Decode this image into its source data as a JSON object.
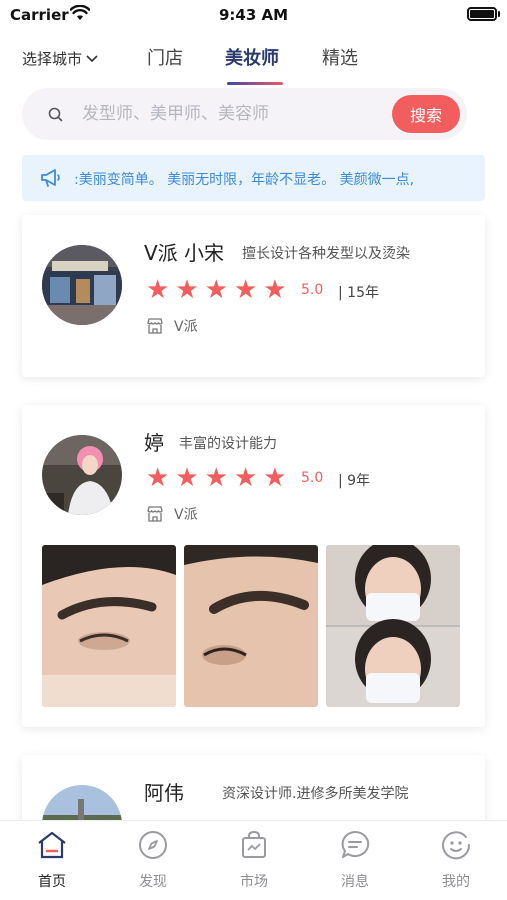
{
  "status_bar": {
    "carrier": "Carrier",
    "time": "9:43 AM"
  },
  "top_nav": {
    "city_label": "选择城市",
    "tabs": [
      {
        "label": "门店",
        "active": false
      },
      {
        "label": "美妆师",
        "active": true
      },
      {
        "label": "精选",
        "active": false
      }
    ]
  },
  "search": {
    "placeholder": "发型师、美甲师、美容师",
    "button_label": "搜索"
  },
  "notice": {
    "text": ":美丽变简单。 美丽无时限，年龄不显老。 美颜微一点,"
  },
  "stylists": [
    {
      "name": "V派 小宋",
      "desc": "擅长设计各种发型以及烫染",
      "rating": "5.0",
      "years": "| 15年",
      "shop": "V派"
    },
    {
      "name": "婷",
      "desc": "丰富的设计能力",
      "rating": "5.0",
      "years": "| 9年",
      "shop": "V派"
    },
    {
      "name": "阿伟",
      "desc": "资深设计师.进修多所美发学院"
    }
  ],
  "tabbar": {
    "items": [
      {
        "label": "首页",
        "icon": "home-icon",
        "active": true
      },
      {
        "label": "发现",
        "icon": "compass-icon",
        "active": false
      },
      {
        "label": "市场",
        "icon": "market-bag-icon",
        "active": false
      },
      {
        "label": "消息",
        "icon": "message-icon",
        "active": false
      },
      {
        "label": "我的",
        "icon": "profile-face-icon",
        "active": false
      }
    ]
  },
  "colors": {
    "accent": "#f25d5d",
    "tab_active": "#2b3a6e",
    "notice_text": "#3d8bdc",
    "notice_bg": "#e8f3fd"
  }
}
